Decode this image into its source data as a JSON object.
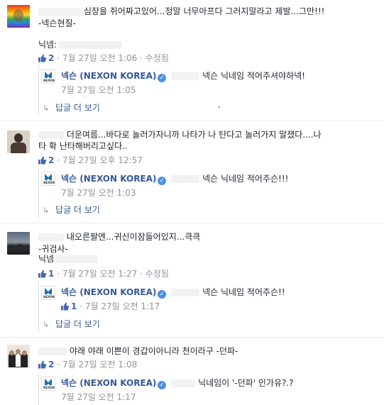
{
  "comments": [
    {
      "text_lines": [
        "심장을 쥐어짜고있어...정말 너무아프다 그러지말라고 제발...그만!!!",
        "-넥슨현질-",
        "닉넴:"
      ],
      "likes": "2",
      "time": "7월 27일 오전 1:06",
      "edited": "수정됨",
      "reply": {
        "author": "넥슨 (NEXON KOREA)",
        "text": "넥슨 닉네임 적어주셔야하넥!",
        "time": "7월 27일 오전 1:05",
        "more": "답글 더 보기"
      }
    },
    {
      "text_lines": [
        "더운여름...바다로 놀러가자니까 나타가 나 탄다고 놀러가지 말쟀다....나",
        "타 확 난타해버리고싶다.."
      ],
      "likes": "2",
      "time": "7월 27일 오후 12:57",
      "reply": {
        "author": "넥슨 (NEXON KOREA)",
        "text": "넥슨 닉네임 적어주슨!!!",
        "time": "7월 27일 오전 1:03",
        "more": "답글 더 보기"
      }
    },
    {
      "text_lines": [
        "내오른팔엔...귀신이잠들어있지...큭큭",
        "-귀검사-",
        "닉넴"
      ],
      "likes": "1",
      "time": "7월 27일 오전 1:27",
      "edited": "수정됨",
      "reply": {
        "author": "넥슨 (NEXON KOREA)",
        "text": "넥슨 닉네임 적어주슨!!",
        "likes": "1",
        "time": "7월 27일 오전 1:17",
        "more": "답글 더 보기"
      }
    },
    {
      "text_lines": [
        "야래 야래 이쁜이 경갑이아니라 천이라구 -던파-"
      ],
      "likes": "2",
      "time": "7월 27일 오전 1:08",
      "reply": {
        "author": "넥슨 (NEXON KOREA)",
        "text": "닉네임이 '-던파' 인가유?.?",
        "time": "7월 27일 오전 1:17"
      }
    }
  ],
  "sep": "·",
  "verified_mark": "✓",
  "nexon_logo_text": "NEXON",
  "colors": {
    "link": "#365899",
    "meta": "#90949c",
    "like": "#4267b2",
    "verified": "#4a90e2"
  },
  "icons": [
    "thumbs-up-icon",
    "verified-badge-icon",
    "reply-arrow-icon",
    "nexon-logo-icon"
  ]
}
